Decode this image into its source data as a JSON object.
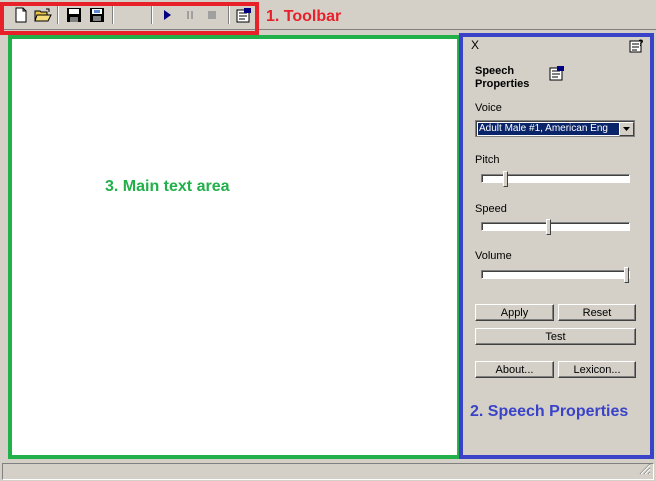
{
  "annotations": {
    "toolbar": "1. Toolbar",
    "speech_properties": "2. Speech Properties",
    "main_text_area": "3. Main text area",
    "colors": {
      "toolbar": "#e8202a",
      "speech": "#3a43c8",
      "main": "#22b04a"
    }
  },
  "toolbar": {
    "buttons": [
      {
        "icon": "new-document-icon"
      },
      {
        "icon": "open-folder-icon"
      },
      {
        "icon": "save-icon"
      },
      {
        "icon": "save-as-audio-icon"
      },
      {
        "icon": "play-icon"
      },
      {
        "icon": "pause-icon"
      },
      {
        "icon": "stop-icon"
      },
      {
        "icon": "properties-icon"
      }
    ]
  },
  "speech_panel": {
    "close_glyph": "X",
    "title": "Speech Properties",
    "voice_label": "Voice",
    "voice_value": "Adult Male #1, American Eng",
    "pitch_label": "Pitch",
    "pitch_level": 0.15,
    "speed_label": "Speed",
    "speed_level": 0.45,
    "volume_label": "Volume",
    "volume_level": 1.0,
    "apply_label": "Apply",
    "reset_label": "Reset",
    "test_label": "Test",
    "about_label": "About...",
    "lexicon_label": "Lexicon..."
  }
}
